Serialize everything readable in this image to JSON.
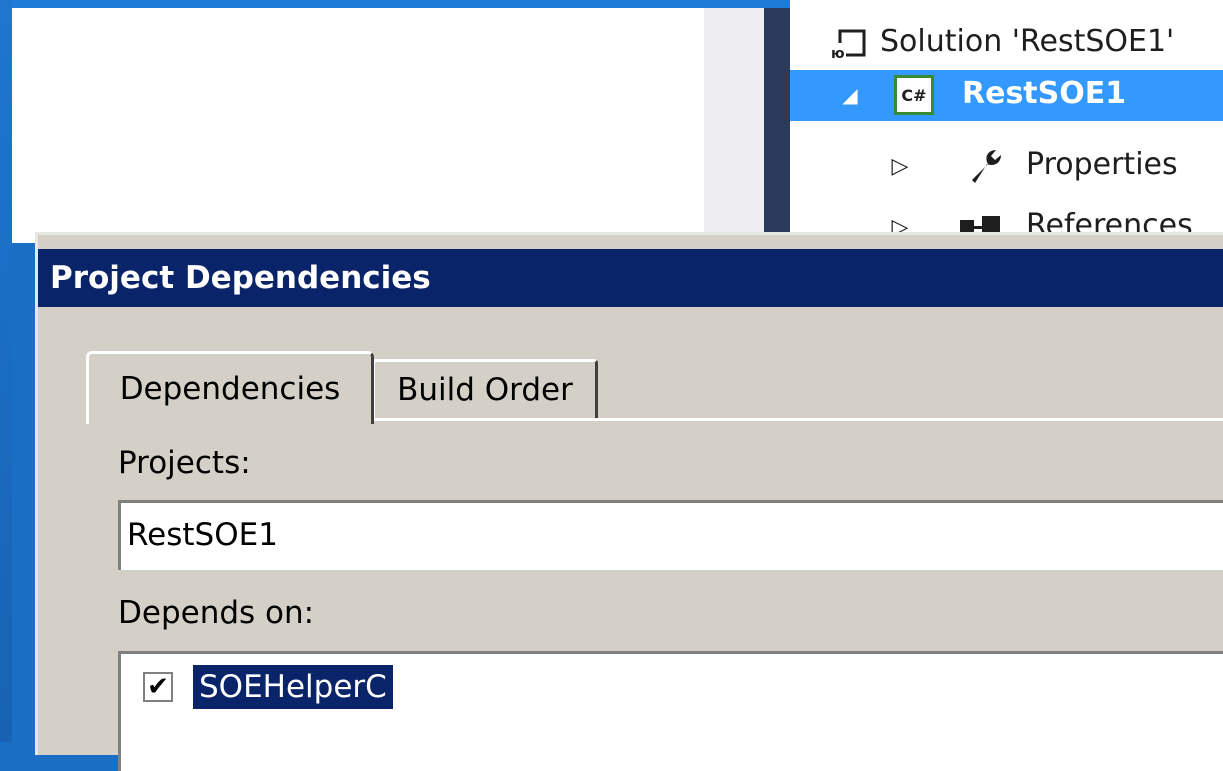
{
  "solution_explorer": {
    "rows": [
      {
        "label": "Solution 'RestSOE1'",
        "icon": "visual-studio-solution-icon",
        "selected": false
      },
      {
        "label": "RestSOE1",
        "icon": "csharp-project-icon",
        "selected": true,
        "expander": "◢"
      },
      {
        "label": "Properties",
        "icon": "wrench-icon",
        "selected": false,
        "expander": "▷"
      },
      {
        "label": "References",
        "icon": "references-icon",
        "selected": false,
        "expander": "▷"
      }
    ]
  },
  "dialog": {
    "title": "Project Dependencies",
    "tabs": [
      {
        "label": "Dependencies",
        "active": true
      },
      {
        "label": "Build Order",
        "active": false
      }
    ],
    "projects_label": "Projects:",
    "projects_value": "RestSOE1",
    "depends_on_label": "Depends on:",
    "depends_on_items": [
      {
        "label": "SOEHelperC",
        "checked": true,
        "check_glyph": "✔"
      }
    ]
  },
  "colors": {
    "title_bar": "#0a246a",
    "selection_blue": "#3399ff",
    "dialog_face": "#d4d0c8",
    "desktop": "#1a6fc4"
  }
}
